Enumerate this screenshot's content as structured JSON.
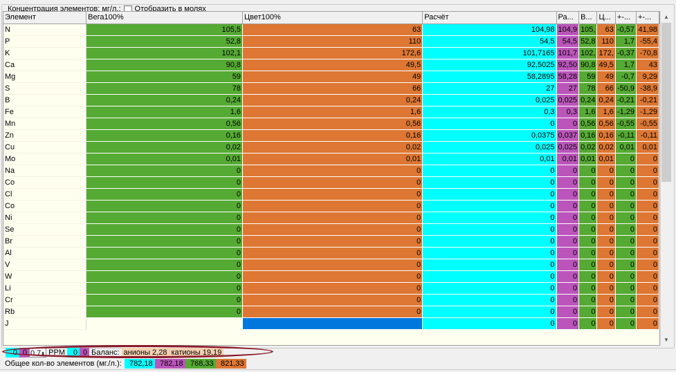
{
  "legend": {
    "title": "Концентрация элементов: мг/л.:",
    "checkbox_label": "Отобразить в молях"
  },
  "columns": [
    "Элемент",
    "Вега100%",
    "Цвет100%",
    "Расчёт",
    "Ра...",
    "В...",
    "Ц...",
    "+-...",
    "+-..."
  ],
  "rows": [
    [
      "N",
      "105,5",
      "63",
      "104,98",
      "104,9",
      "105,",
      "63",
      "-0,57",
      "41,98"
    ],
    [
      "P",
      "52,8",
      "110",
      "54,5",
      "54,5",
      "52,8",
      "110",
      "1,7",
      "-55,4"
    ],
    [
      "K",
      "102,1",
      "172,6",
      "101,7165",
      "101,7",
      "102,",
      "172,",
      "-0,37",
      "-70,8"
    ],
    [
      "Ca",
      "90,8",
      "49,5",
      "92,5025",
      "92,50",
      "90,8",
      "49,5",
      "1,7",
      "43"
    ],
    [
      "Mg",
      "59",
      "49",
      "58,2895",
      "58,28",
      "59",
      "49",
      "-0,7",
      "9,29"
    ],
    [
      "S",
      "78",
      "66",
      "27",
      "27",
      "78",
      "66",
      "-50,9",
      "-38,9"
    ],
    [
      "B",
      "0,24",
      "0,24",
      "0,025",
      "0,025",
      "0,24",
      "0,24",
      "-0,21",
      "-0,21"
    ],
    [
      "Fe",
      "1,6",
      "1,6",
      "0,3",
      "0,3",
      "1,6",
      "1,6",
      "-1,29",
      "-1,29"
    ],
    [
      "Mn",
      "0,56",
      "0,56",
      "0",
      "0",
      "0,56",
      "0,56",
      "-0,55",
      "-0,55"
    ],
    [
      "Zn",
      "0,16",
      "0,16",
      "0,0375",
      "0,037",
      "0,16",
      "0,16",
      "-0,11",
      "-0,11"
    ],
    [
      "Cu",
      "0,02",
      "0,02",
      "0,025",
      "0,025",
      "0,02",
      "0,02",
      "0,01",
      "0,01"
    ],
    [
      "Mo",
      "0,01",
      "0,01",
      "0,01",
      "0,01",
      "0,01",
      "0,01",
      "0",
      "0"
    ],
    [
      "Na",
      "0",
      "0",
      "0",
      "0",
      "0",
      "0",
      "0",
      "0"
    ],
    [
      "Co",
      "0",
      "0",
      "0",
      "0",
      "0",
      "0",
      "0",
      "0"
    ],
    [
      "Cl",
      "0",
      "0",
      "0",
      "0",
      "0",
      "0",
      "0",
      "0"
    ],
    [
      "Co",
      "0",
      "0",
      "0",
      "0",
      "0",
      "0",
      "0",
      "0"
    ],
    [
      "Ni",
      "0",
      "0",
      "0",
      "0",
      "0",
      "0",
      "0",
      "0"
    ],
    [
      "Se",
      "0",
      "0",
      "0",
      "0",
      "0",
      "0",
      "0",
      "0"
    ],
    [
      "Br",
      "0",
      "0",
      "0",
      "0",
      "0",
      "0",
      "0",
      "0"
    ],
    [
      "Al",
      "0",
      "0",
      "0",
      "0",
      "0",
      "0",
      "0",
      "0"
    ],
    [
      "V",
      "0",
      "0",
      "0",
      "0",
      "0",
      "0",
      "0",
      "0"
    ],
    [
      "W",
      "0",
      "0",
      "0",
      "0",
      "0",
      "0",
      "0",
      "0"
    ],
    [
      "Li",
      "0",
      "0",
      "0",
      "0",
      "0",
      "0",
      "0",
      "0"
    ],
    [
      "Cr",
      "0",
      "0",
      "0",
      "0",
      "0",
      "0",
      "0",
      "0"
    ],
    [
      "Rb",
      "0",
      "0",
      "0",
      "0",
      "0",
      "0",
      "0",
      "0"
    ],
    [
      "J",
      "",
      "",
      "0",
      "0",
      "0",
      "0",
      "0",
      "0"
    ]
  ],
  "status_row1": {
    "v1": "0",
    "v2": "0",
    "ph": "0.7",
    "ppm_label": "PPM",
    "ppm_v1": "0",
    "ppm_v2": "0",
    "balance_label": "Баланс:",
    "anions": "анионы 2,28",
    "cations": "катионы 19,19"
  },
  "status_row2": {
    "label": "Общее кол-во элементов (мг./л.):",
    "totals": [
      "782,18",
      "782,18",
      "768,33",
      "821,33"
    ]
  },
  "colors": {
    "vega": "#55aa33",
    "cvet": "#dd7733",
    "calc": "#00ffff",
    "ra": "#bb55bb",
    "highlight_oval": "#8a1a2a",
    "blue_cell": "#0077dd"
  }
}
